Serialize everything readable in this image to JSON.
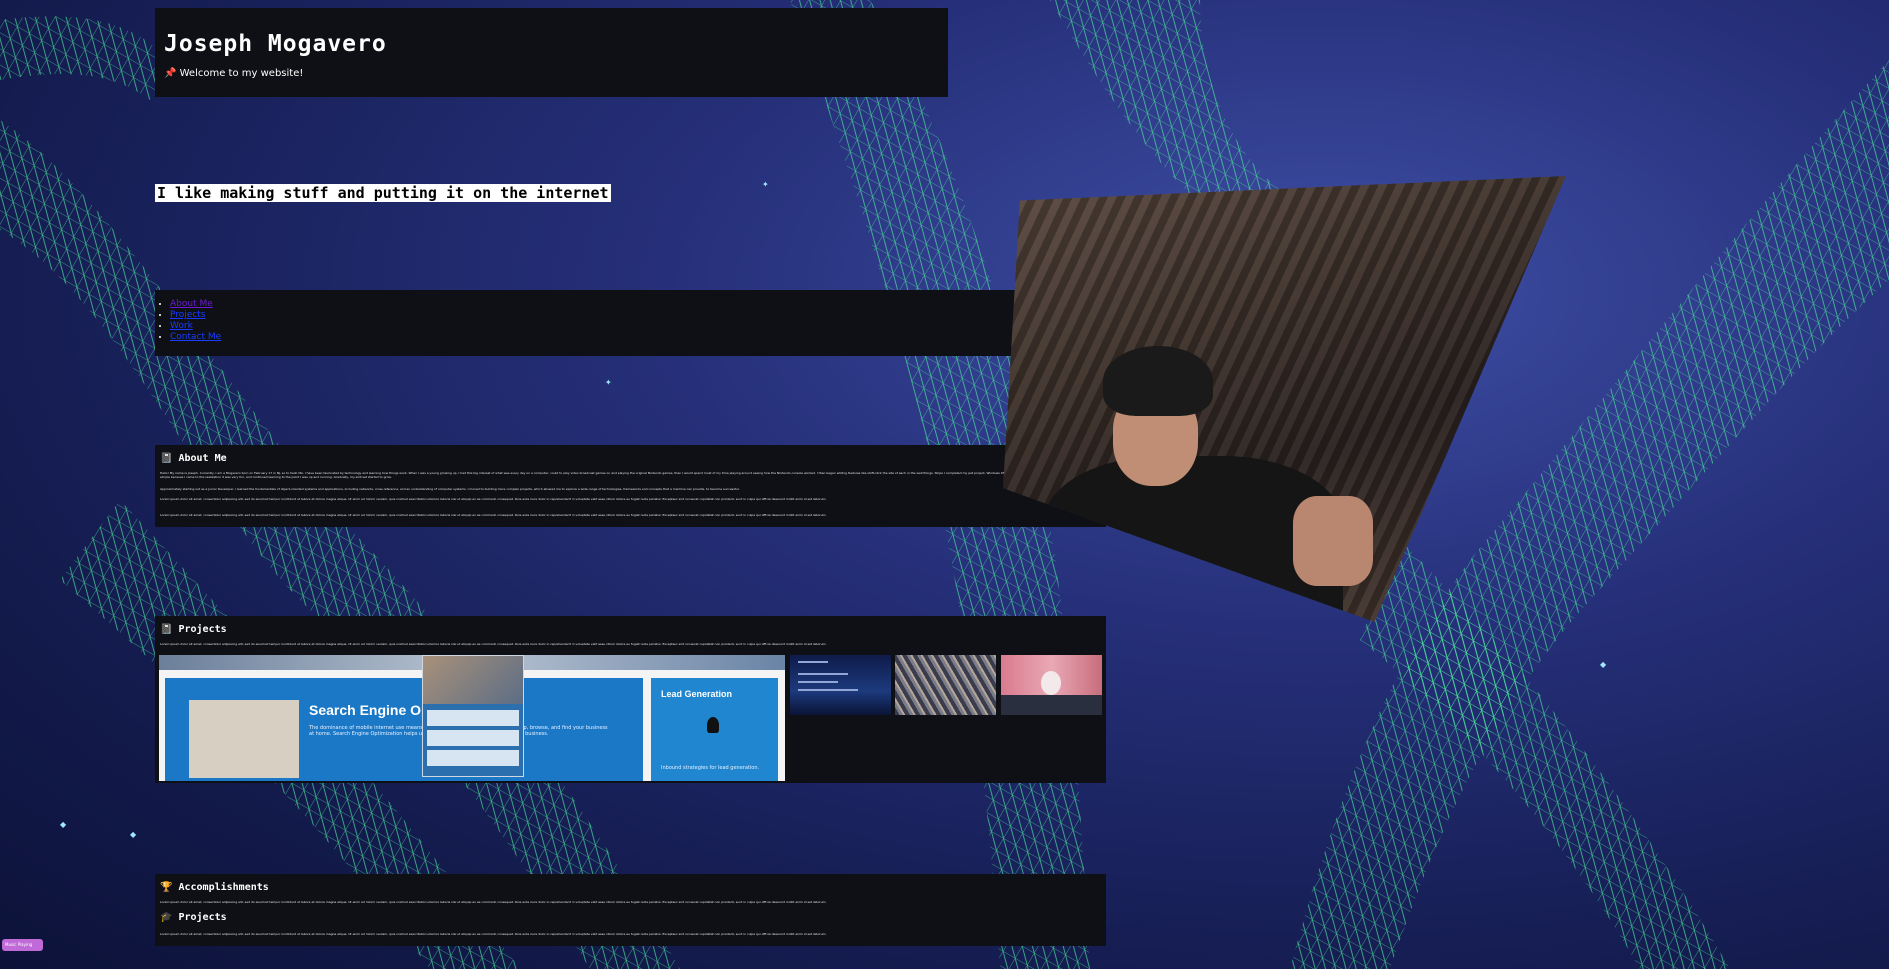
{
  "header": {
    "title": "Joseph Mogavero",
    "welcome": "📌 Welcome to my website!"
  },
  "tagline": "I like making stuff and putting it on the internet",
  "nav": {
    "items": [
      {
        "label": "About Me"
      },
      {
        "label": "Projects"
      },
      {
        "label": "Work"
      },
      {
        "label": "Contact Me"
      }
    ]
  },
  "about": {
    "title": "📓 About Me",
    "p1": "Hello! My name is Joseph. Currently, I am a Mogavero born on February 17 in NJ, so to hello life. I have been fascinated by technology and learning how things work. When I was a young growing up, I had this big interest of what was every day on a computer, could to play video broadcast games on and playing the original Nintendo games, then I would spend most of my time playing around seeing how the Nintendo console worked. I then began adding features like shift-click the site of each in the wall things. Stops I completed my pet project, Windows 95 and the computer is ready then other applications. I started off simple because I came to the realization it was very fun, and continued learning to the point I was up and running. Gradually, my skill set started to grow.",
    "p2": "Approximately starting out as a Junior Developer, I learned the fundamentals of object-oriented systems and applications, including networks, cross-reference, and an understanding of computer systems. I moved to building more complex projects, which allowed me to explore a wide range of technologies, frameworks and concepts that a machine can provide, to become successful.",
    "p3": "Lorem ipsum dolor sit amet, consectetur adipiscing elit, sed do eiusmod tempor incididunt ut labore et dolore magna aliqua. Ut enim ad minim veniam, quis nostrud exercitation ullamco laboris nisi ut aliquip ex ea commodo consequat. Duis aute irure dolor in reprehenderit in voluptate velit esse cillum dolore eu fugiat nulla pariatur. Excepteur sint occaecat cupidatat non proident, sunt in culpa qui officia deserunt mollit anim id est laborum.",
    "p4": "Lorem ipsum dolor sit amet, consectetur adipiscing elit, sed do eiusmod tempor incididunt ut labore et dolore magna aliqua. Ut enim ad minim veniam, quis nostrud exercitation ullamco laboris nisi ut aliquip ex ea commodo consequat. Duis aute irure dolor in reprehenderit in voluptate velit esse cillum dolore eu fugiat nulla pariatur. Excepteur sint occaecat cupidatat non proident, sunt in culpa qui officia deserunt mollit anim id est laborum."
  },
  "projects": {
    "title": "📓 Projects",
    "desc": "Lorem ipsum dolor sit amet, consectetur adipiscing elit, sed do eiusmod tempor incididunt ut labore et dolore magna aliqua. Ut enim ad minim veniam, quis nostrud exercitation ullamco laboris nisi ut aliquip ex ea commodo consequat. Duis aute irure dolor in reprehenderit in voluptate velit esse cillum dolore eu fugiat nulla pariatur. Excepteur sint occaecat cupidatat non proident, sunt in culpa qui officia deserunt mollit anim id est laborum.",
    "thumb_main": {
      "seo_title": "Search Engine Optimization",
      "seo_desc": "The dominance of mobile internet use means that more people than ever search, shop, browse, and find your business at home. Search Engine Optimization helps users find and the right audience for your business.",
      "lead_title": "Lead Generation",
      "lead_desc": "Inbound strategies for lead generation."
    }
  },
  "accomplishments": {
    "title": "🏆 Accomplishments",
    "desc": "Lorem ipsum dolor sit amet, consectetur adipiscing elit, sed do eiusmod tempor incididunt ut labore et dolore magna aliqua. Ut enim ad minim veniam, quis nostrud exercitation ullamco laboris nisi ut aliquip ex ea commodo consequat. Duis aute irure dolor in reprehenderit in voluptate velit esse cillum dolore eu fugiat nulla pariatur. Excepteur sint occaecat cupidatat non proident, sunt in culpa qui officia deserunt mollit anim id est laborum.",
    "sub_title": "🎓 Projects",
    "sub_desc": "Lorem ipsum dolor sit amet, consectetur adipiscing elit, sed do eiusmod tempor incididunt ut labore et dolore magna aliqua. Ut enim ad minim veniam, quis nostrud exercitation ullamco laboris nisi ut aliquip ex ea commodo consequat. Duis aute irure dolor in reprehenderit in voluptate velit esse cillum dolore eu fugiat nulla pariatur. Excepteur sint occaecat cupidatat non proident, sunt in culpa qui officia deserunt mollit anim id est laborum."
  },
  "badge": "Music Playing",
  "colors": {
    "panel_bg": "#0e1016",
    "link": "#1a3cff",
    "link_visited": "#6a1ad0",
    "grid_green": "#3ecf8e",
    "space_blue": "#26307a",
    "badge": "#c06ad8"
  }
}
